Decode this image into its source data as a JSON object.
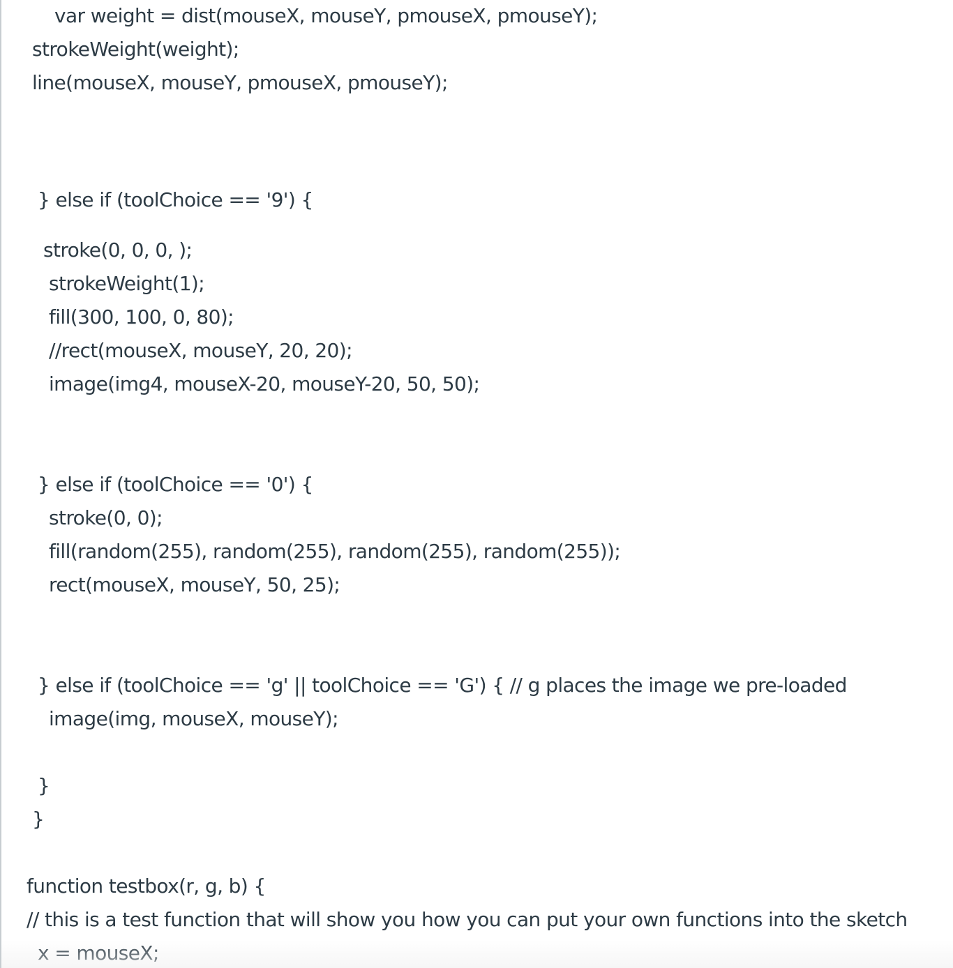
{
  "code_lines": [
    "var weight = dist(mouseX, mouseY, pmouseX, pmouseY);",
    "strokeWeight(weight);",
    "line(mouseX, mouseY, pmouseX, pmouseY);",
    "} else if (toolChoice == '9') {",
    "stroke(0, 0, 0, );",
    "strokeWeight(1);",
    "fill(300, 100, 0, 80);",
    "//rect(mouseX, mouseY, 20, 20);",
    "image(img4, mouseX-20, mouseY-20, 50, 50);",
    "} else if (toolChoice == '0') {",
    "stroke(0, 0);",
    "fill(random(255), random(255), random(255), random(255));",
    "rect(mouseX, mouseY, 50, 25);",
    "} else if (toolChoice == 'g' || toolChoice == 'G') { // g places the image we pre-loaded",
    "image(img, mouseX, mouseY);",
    "}",
    "}",
    "function testbox(r, g, b) {",
    "// this is a test function that will show you how you can put your own functions into the sketch",
    "x = mouseX;"
  ]
}
